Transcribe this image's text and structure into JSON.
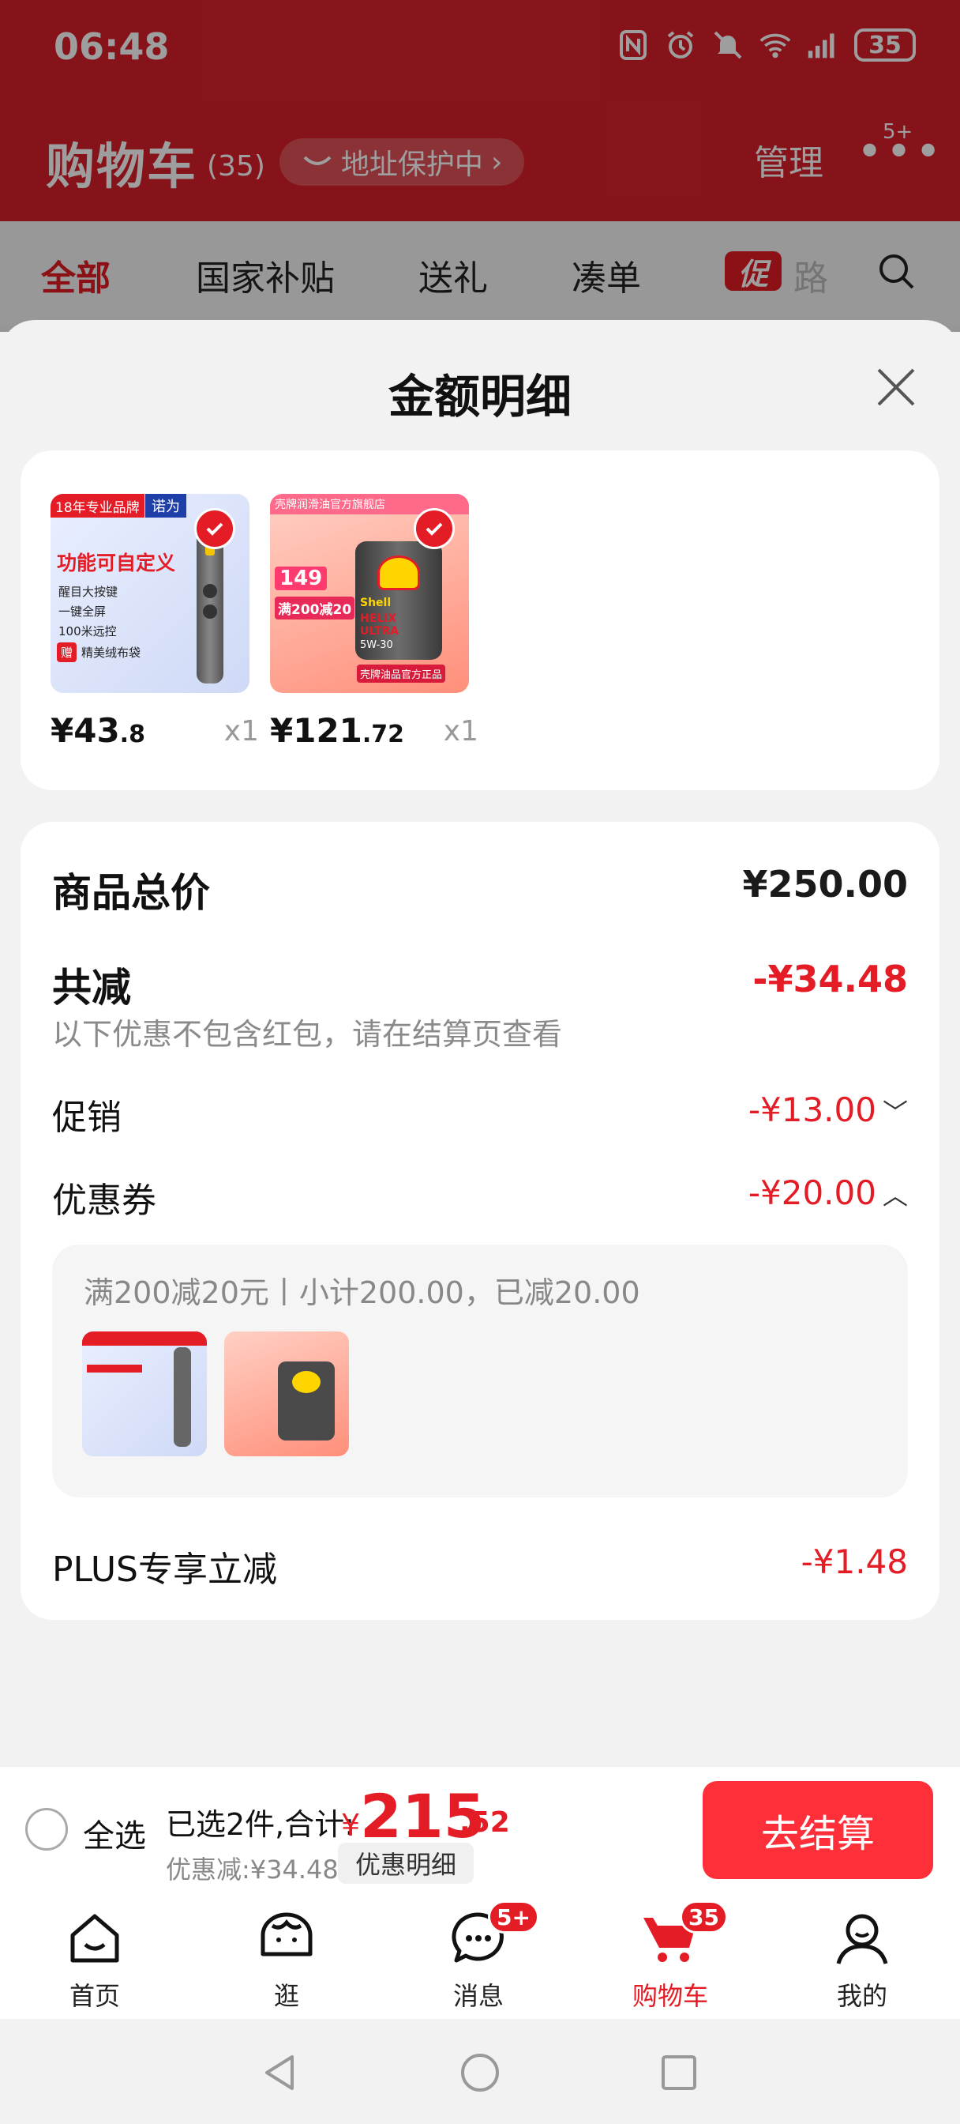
{
  "status_bar": {
    "time": "06:48",
    "battery": "35"
  },
  "header": {
    "title": "购物车",
    "count": "(35)",
    "address_pill": "地址保护中",
    "manage": "管理",
    "more_badge": "5+"
  },
  "filter_tabs": [
    {
      "label": "全部"
    },
    {
      "label": "国家补贴"
    },
    {
      "label": "送礼"
    },
    {
      "label": "凑单"
    }
  ],
  "promo_chip": "促",
  "promo_tail": "路",
  "sheet": {
    "title": "金额明细",
    "products": [
      {
        "price_int": "¥43",
        "price_dec": ".8",
        "qty": "x1",
        "image": {
          "brand_tag": "18年专业品牌",
          "brand": "诺为",
          "headline": "功能可自定义",
          "bullets": [
            "醒目大按键",
            "一键全屏",
            "100米远控"
          ],
          "gift_tag": "赠",
          "gift": "精美绒布袋"
        }
      },
      {
        "price_int": "¥121",
        "price_dec": ".72",
        "qty": "x1",
        "image": {
          "top_banner": "壳牌润滑油官方旗舰店",
          "price_tag": "149",
          "promo": "满200减20",
          "brand": "Shell",
          "product": "HELIX ULTRA",
          "spec": "5W-30",
          "footer": "壳牌油品官方正品"
        }
      }
    ],
    "summary": {
      "total_label": "商品总价",
      "total_value": "¥250.00",
      "reduce_label": "共减",
      "reduce_value": "-¥34.48",
      "note": "以下优惠不包含红包，请在结算页查看",
      "promo_label": "促销",
      "promo_value": "-¥13.00",
      "coupon_label": "优惠券",
      "coupon_value": "-¥20.00",
      "coupon_detail": "满200减20元丨小计200.00，已减20.00",
      "plus_label": "PLUS专享立减",
      "plus_value": "-¥1.48"
    }
  },
  "checkout": {
    "select_all": "全选",
    "selected_text": "已选2件,合计:",
    "currency": "¥",
    "total_int": "215",
    "total_dec": ".52",
    "discount_text": "优惠减:¥34.48",
    "detail_chip": "优惠明细",
    "button": "去结算"
  },
  "tabbar": [
    {
      "label": "首页",
      "icon": "home-icon"
    },
    {
      "label": "逛",
      "icon": "stroll-icon"
    },
    {
      "label": "消息",
      "icon": "message-icon",
      "badge": "5+"
    },
    {
      "label": "购物车",
      "icon": "cart-icon",
      "badge": "35",
      "active": true
    },
    {
      "label": "我的",
      "icon": "profile-icon"
    }
  ],
  "colors": {
    "brand_red": "#e31c25",
    "button_red": "#ff2f3a",
    "header_red": "#d9202b"
  }
}
